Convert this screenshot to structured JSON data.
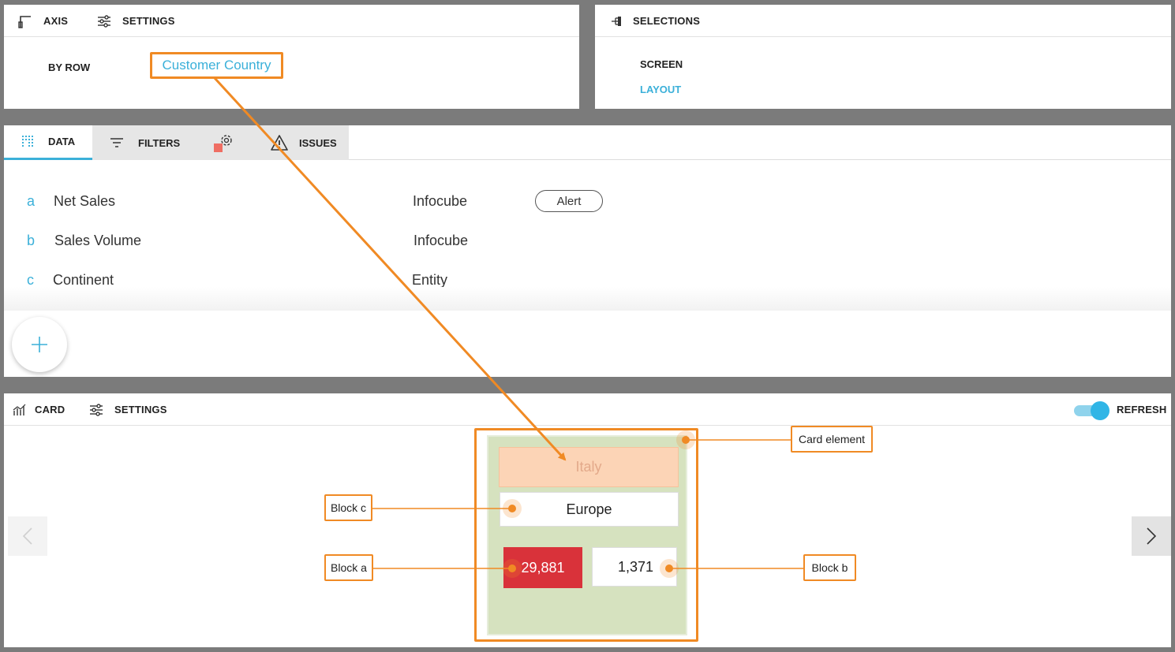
{
  "axis": {
    "title": "AXIS",
    "settings_label": "SETTINGS",
    "by_row_label": "BY ROW",
    "by_row_value": "Customer Country"
  },
  "selections": {
    "title": "SELECTIONS",
    "items": [
      "SCREEN",
      "LAYOUT"
    ]
  },
  "data_panel": {
    "tabs": [
      {
        "label": "DATA",
        "icon": "grid-icon",
        "active": true
      },
      {
        "label": "FILTERS",
        "icon": "filter-icon",
        "active": false
      },
      {
        "label": "",
        "icon": "gear-warning-icon",
        "active": false
      },
      {
        "label": "ISSUES",
        "icon": "warning-icon",
        "active": false
      }
    ],
    "rows": [
      {
        "letter": "a",
        "name": "Net Sales",
        "source": "Infocube",
        "badge": "Alert"
      },
      {
        "letter": "b",
        "name": "Sales Volume",
        "source": "Infocube",
        "badge": ""
      },
      {
        "letter": "c",
        "name": "Continent",
        "source": "Entity",
        "badge": ""
      }
    ],
    "add_icon": "plus-icon"
  },
  "card_panel": {
    "title": "CARD",
    "settings_label": "SETTINGS",
    "refresh_label": "REFRESH",
    "refresh_on": true,
    "card": {
      "title": "Italy",
      "block_c": "Europe",
      "block_a": "29,881",
      "block_b": "1,371"
    },
    "callouts": {
      "card_element": "Card element",
      "block_c": "Block c",
      "block_a": "Block a",
      "block_b": "Block  b"
    }
  },
  "colors": {
    "accent": "#3bb0d9",
    "annotation": "#f08a24",
    "card_bg": "#d6e2bf",
    "title_bg": "#fcd4b6",
    "alert_red": "#d9323a"
  }
}
